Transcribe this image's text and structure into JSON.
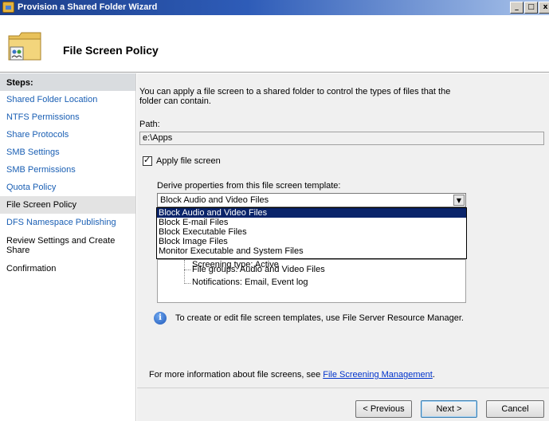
{
  "window": {
    "title": "Provision a Shared Folder Wizard",
    "buttons": {
      "minimize": "_",
      "maximize": "□",
      "close": "x"
    }
  },
  "header": {
    "title": "File Screen Policy",
    "icon": "folder-share-icon"
  },
  "steps": {
    "heading": "Steps:",
    "items": [
      {
        "label": "Shared Folder Location",
        "state": "link"
      },
      {
        "label": "NTFS Permissions",
        "state": "link"
      },
      {
        "label": "Share Protocols",
        "state": "link"
      },
      {
        "label": "SMB Settings",
        "state": "link"
      },
      {
        "label": "SMB Permissions",
        "state": "link"
      },
      {
        "label": "Quota Policy",
        "state": "link"
      },
      {
        "label": "File Screen Policy",
        "state": "current"
      },
      {
        "label": "DFS Namespace Publishing",
        "state": "link"
      },
      {
        "label": "Review Settings and Create Share",
        "state": "plain"
      },
      {
        "label": "Confirmation",
        "state": "plain"
      }
    ]
  },
  "main": {
    "description": "You can apply a file screen to a shared folder to control the types of files that the folder can contain.",
    "path_label": "Path:",
    "path_value": "e:\\Apps",
    "apply_label": "Apply file screen",
    "apply_checked": true,
    "template_label": "Derive properties from this file screen template:",
    "template_selected": "Block Audio and Video Files",
    "template_options": [
      "Block Audio and Video Files",
      "Block E-mail Files",
      "Block Executable Files",
      "Block Image Files",
      "Monitor Executable and System Files"
    ],
    "properties": {
      "screening_type": "Screening type: Active",
      "file_groups": "File groups: Audio and Video Files",
      "notifications": "Notifications: Email, Event log"
    },
    "info_text": "To create or edit file screen templates, use File Server Resource Manager.",
    "more_info_prefix": "For more information about file screens, see ",
    "more_info_link": "File Screening Management",
    "more_info_suffix": "."
  },
  "buttons": {
    "previous": "< Previous",
    "next": "Next >",
    "cancel": "Cancel"
  },
  "colors": {
    "title_gradient_start": "#1c3f8a",
    "link": "#1a5fb4",
    "selection": "#0a246a"
  }
}
